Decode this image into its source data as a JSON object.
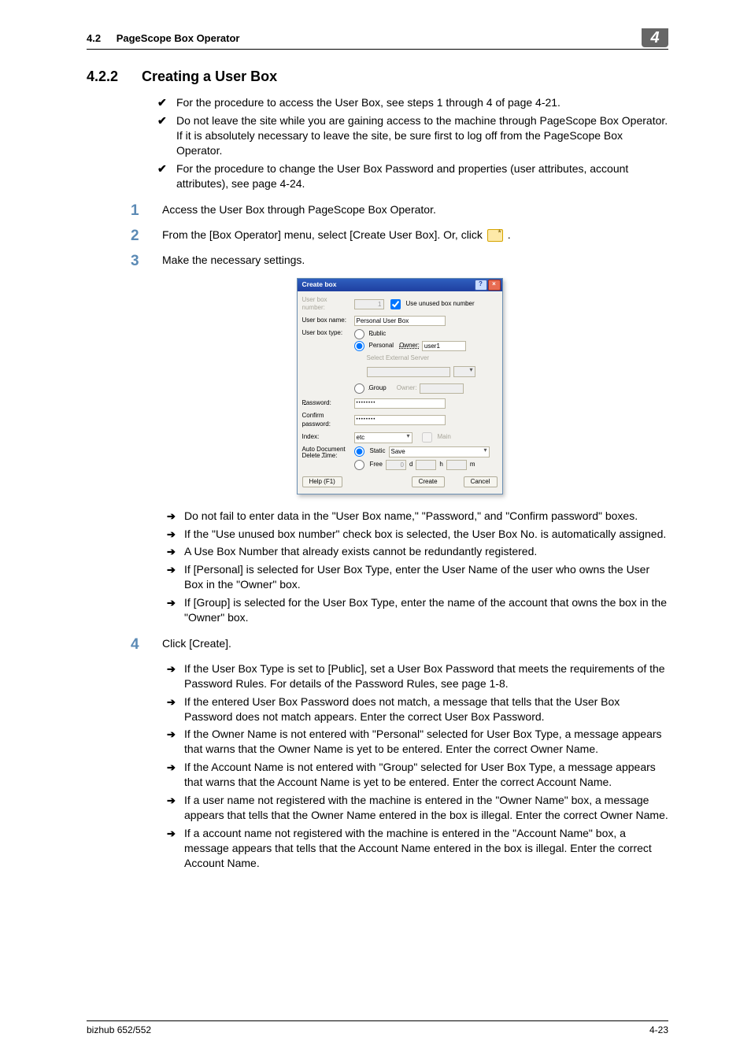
{
  "header": {
    "section_number": "4.2",
    "section_title": "PageScope Box Operator",
    "chapter_number": "4"
  },
  "heading": {
    "number": "4.2.2",
    "title": "Creating a User Box"
  },
  "intro_checks": [
    "For the procedure to access the User Box, see steps 1 through 4 of page 4-21.",
    "Do not leave the site while you are gaining access to the machine through PageScope Box Operator. If it is absolutely necessary to leave the site, be sure first to log off from the PageScope Box Operator.",
    "For the procedure to change the User Box Password and properties (user attributes, account attributes), see page 4-24."
  ],
  "steps": {
    "s1": {
      "num": "1",
      "text": "Access the User Box through PageScope Box Operator."
    },
    "s2": {
      "num": "2",
      "text_a": "From the [Box Operator] menu, select [Create User Box]. Or, click ",
      "text_b": "."
    },
    "s3": {
      "num": "3",
      "text": "Make the necessary settings."
    },
    "s4": {
      "num": "4",
      "text": "Click [Create]."
    }
  },
  "notes_after_dialog": [
    "Do not fail to enter data in the \"User Box name,\" \"Password,\" and \"Confirm password\" boxes.",
    "If the \"Use unused box number\" check box is selected, the User Box No. is automatically assigned.",
    "A Use Box Number that already exists cannot be redundantly registered.",
    "If [Personal] is selected for User Box Type, enter the User Name of the user who owns the User Box in the \"Owner\" box.",
    "If [Group] is selected for the User Box Type, enter the name of the account that owns the box in the \"Owner\" box."
  ],
  "notes_after_step4": [
    "If the User Box Type is set to [Public], set a User Box Password that meets the requirements of the Password Rules. For details of the Password Rules, see page 1-8.",
    "If the entered User Box Password does not match, a message that tells that the User Box Password does not match appears. Enter the correct User Box Password.",
    "If the Owner Name is not entered with \"Personal\" selected for User Box Type, a message appears that warns that the Owner Name is yet to be entered. Enter the correct Owner Name.",
    "If the Account Name is not entered with \"Group\" selected for User Box Type, a message appears that warns that the Account Name is yet to be entered. Enter the correct Account Name.",
    "If a user name not registered with the machine is entered in the \"Owner Name\" box, a message appears that tells that the Owner Name entered in the box is illegal. Enter the correct Owner Name.",
    "If a account name not registered with the machine is entered in the \"Account Name\" box, a message appears that tells that the Account Name entered in the box is illegal. Enter the correct Account Name."
  ],
  "dialog": {
    "title": "Create box",
    "user_box_number_label": "User box number:",
    "use_unused_label": "Use unused box number",
    "user_box_name_label": "User box name:",
    "user_box_name_value": "Personal User Box",
    "user_box_type_label": "User box type:",
    "public_label": "Public",
    "personal_label": "Personal",
    "owner_label_personal": "Owner:",
    "owner_value": "user1",
    "select_ext_server": "Select External Server",
    "group_label": "Group",
    "owner_label_group": "Owner:",
    "password_label": "Password:",
    "password_value": "••••••••",
    "confirm_pw_label": "Confirm password:",
    "confirm_pw_value": "••••••••",
    "index_label": "Index:",
    "index_value": "etc",
    "main_checkbox": "Main",
    "autodel_label1": "Auto Document",
    "autodel_label2": "Delete Time:",
    "static_label": "Static",
    "static_value": "Save",
    "free_label": "Free",
    "free_d": "0",
    "free_h": "h",
    "free_m": "m",
    "help_btn": "Help (F1)",
    "create_btn": "Create",
    "cancel_btn": "Cancel"
  },
  "footer": {
    "left": "bizhub 652/552",
    "right": "4-23"
  }
}
